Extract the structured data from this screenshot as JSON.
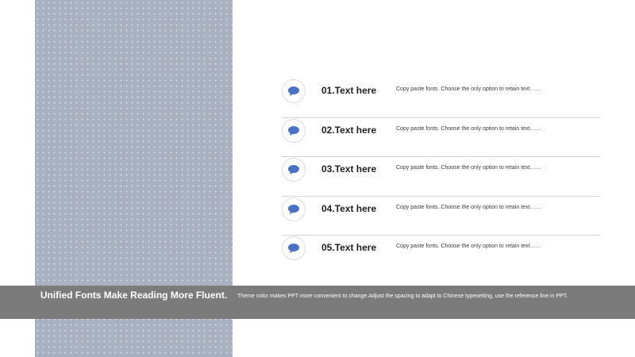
{
  "colors": {
    "panel": "#a9b1c1",
    "band": "#7b7b7b",
    "icon": "#4a72c4",
    "divider": "#d4d4d4"
  },
  "items": [
    {
      "title": "01.Text here",
      "desc": "Copy paste fonts. Choose the only option to retain text……",
      "icon": "chat-bubble-icon"
    },
    {
      "title": "02.Text here",
      "desc": "Copy paste fonts. Choose the only option to retain text……",
      "icon": "chat-bubble-icon"
    },
    {
      "title": "03.Text here",
      "desc": "Copy paste fonts. Choose the only option to retain text……",
      "icon": "chat-bubble-icon"
    },
    {
      "title": "04.Text here",
      "desc": "Copy paste fonts. Choose the only option to retain text……",
      "icon": "chat-bubble-icon"
    },
    {
      "title": "05.Text here",
      "desc": "Copy paste fonts. Choose the only option to retain text……",
      "icon": "chat-bubble-icon"
    }
  ],
  "band": {
    "title": "Unified Fonts Make Reading More Fluent.",
    "text": "Theme color makes PPT more convenient to change.Adjust the spacing to adapt to Chinese typesetting, use the reference line in PPT."
  }
}
